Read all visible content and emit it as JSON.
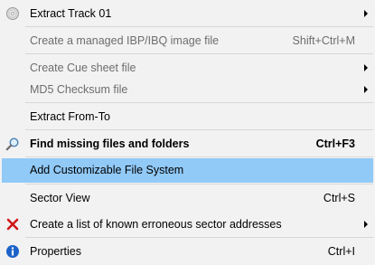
{
  "menu": {
    "items": [
      {
        "label": "Extract Track 01",
        "shortcut": "",
        "icon": "cd-disc-icon"
      },
      {
        "label": "Create a managed IBP/IBQ image file",
        "shortcut": "Shift+Ctrl+M"
      },
      {
        "label": "Create Cue sheet file",
        "shortcut": ""
      },
      {
        "label": "MD5 Checksum file",
        "shortcut": ""
      },
      {
        "label": "Extract From-To",
        "shortcut": ""
      },
      {
        "label": "Find missing files and folders",
        "shortcut": "Ctrl+F3",
        "icon": "magnifier-icon"
      },
      {
        "label": "Add Customizable File System",
        "shortcut": ""
      },
      {
        "label": "Sector View",
        "shortcut": "Ctrl+S"
      },
      {
        "label": "Create a list of known erroneous sector addresses",
        "shortcut": "",
        "icon": "red-x-icon"
      },
      {
        "label": "Properties",
        "shortcut": "Ctrl+I",
        "icon": "info-icon"
      }
    ]
  },
  "colors": {
    "highlight": "#91c9f7",
    "disabled_text": "#6d6d6d",
    "background": "#f2f2f2"
  }
}
